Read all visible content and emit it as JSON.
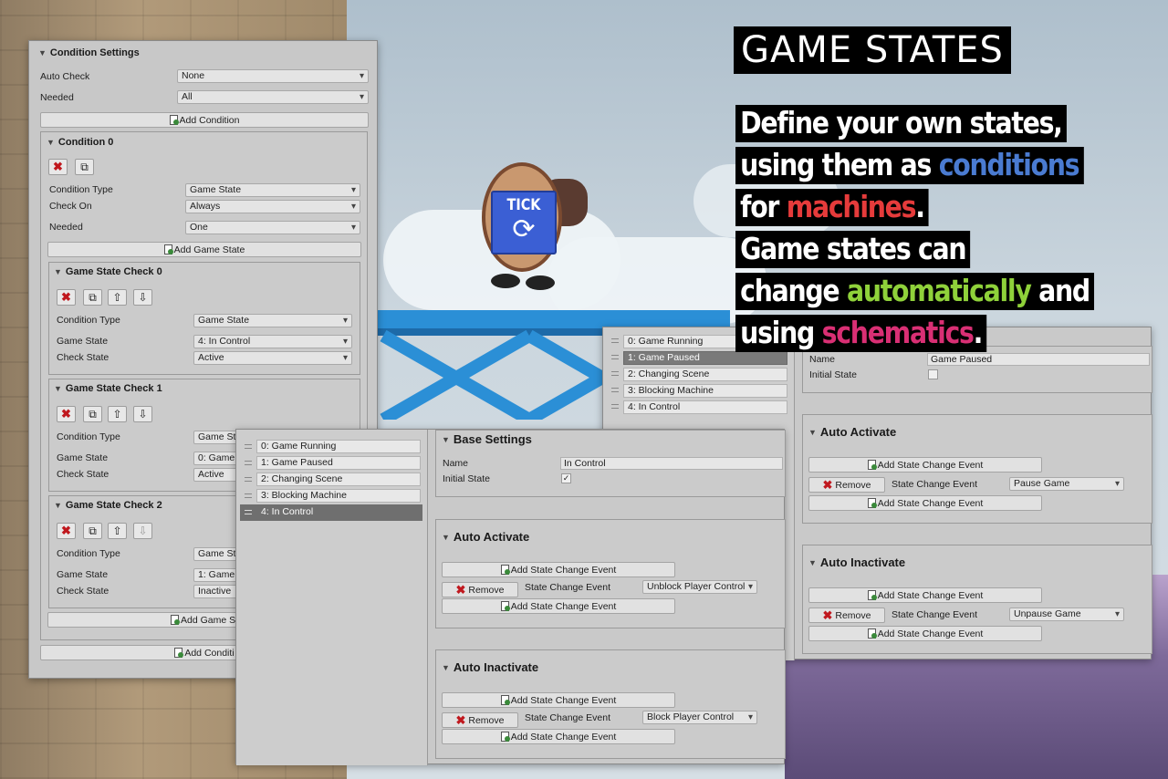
{
  "headline": {
    "title": "GAME STATES",
    "lines": [
      {
        "parts": [
          {
            "t": "Define your own states,",
            "c": "#ffffff"
          }
        ]
      },
      {
        "parts": [
          {
            "t": "using them as ",
            "c": "#ffffff"
          },
          {
            "t": "conditions",
            "c": "#4a7bd1"
          }
        ]
      },
      {
        "parts": [
          {
            "t": "for ",
            "c": "#ffffff"
          },
          {
            "t": "machines",
            "c": "#e63b3b"
          },
          {
            "t": ".",
            "c": "#ffffff"
          }
        ]
      },
      {
        "parts": [
          {
            "t": "Game states can",
            "c": "#ffffff"
          }
        ]
      },
      {
        "parts": [
          {
            "t": "change ",
            "c": "#ffffff"
          },
          {
            "t": "automatically",
            "c": "#8fd13a"
          },
          {
            "t": " and",
            "c": "#ffffff"
          }
        ]
      },
      {
        "parts": [
          {
            "t": "using ",
            "c": "#ffffff"
          },
          {
            "t": "schematics",
            "c": "#d92f74"
          },
          {
            "t": ".",
            "c": "#ffffff"
          }
        ]
      }
    ]
  },
  "tick": {
    "label": "TICK"
  },
  "condition_settings": {
    "title": "Condition Settings",
    "auto_check_label": "Auto Check",
    "auto_check_value": "None",
    "needed_label": "Needed",
    "needed_value": "All",
    "add_condition": "Add Condition",
    "condition0": {
      "title": "Condition 0",
      "type_label": "Condition Type",
      "type_value": "Game State",
      "check_on_label": "Check On",
      "check_on_value": "Always",
      "needed_label": "Needed",
      "needed_value": "One",
      "add_game_state": "Add Game State"
    },
    "checks": [
      {
        "title": "Game State Check 0",
        "type_label": "Condition Type",
        "type_value": "Game State",
        "gs_label": "Game State",
        "gs_value": "4: In Control",
        "cs_label": "Check State",
        "cs_value": "Active"
      },
      {
        "title": "Game State Check 1",
        "type_label": "Condition Type",
        "type_value": "Game St",
        "gs_label": "Game State",
        "gs_value": "0: Game",
        "cs_label": "Check State",
        "cs_value": "Active"
      },
      {
        "title": "Game State Check 2",
        "type_label": "Condition Type",
        "type_value": "Game St",
        "gs_label": "Game State",
        "gs_value": "1: Game",
        "cs_label": "Check State",
        "cs_value": "Inactive"
      }
    ],
    "add_game_state_bottom": "Add Game St",
    "add_condition_bottom": "Add Conditi"
  },
  "states_list": [
    "0: Game Running",
    "1: Game Paused",
    "2: Changing Scene",
    "3: Blocking Machine",
    "4: In Control"
  ],
  "editor_front": {
    "base_title": "Base Settings",
    "name_label": "Name",
    "name_value": "In Control",
    "initial_label": "Initial State",
    "initial_check": "✓",
    "auto_activate": {
      "title": "Auto Activate",
      "add": "Add State Change Event",
      "remove": "Remove",
      "event_label": "State Change Event",
      "event_value": "Unblock Player Control",
      "add2": "Add State Change Event"
    },
    "auto_inactivate": {
      "title": "Auto Inactivate",
      "add": "Add State Change Event",
      "remove": "Remove",
      "event_label": "State Change Event",
      "event_value": "Block Player Control",
      "add2": "Add State Change Event"
    }
  },
  "editor_back": {
    "name_label": "Name",
    "name_value": "Game Paused",
    "initial_label": "Initial State",
    "auto_activate": {
      "title": "Auto Activate",
      "add": "Add State Change Event",
      "remove": "Remove",
      "event_label": "State Change Event",
      "event_value": "Pause Game",
      "add2": "Add State Change Event"
    },
    "auto_inactivate": {
      "title": "Auto Inactivate",
      "add": "Add State Change Event",
      "remove": "Remove",
      "event_label": "State Change Event",
      "event_value": "Unpause Game",
      "add2": "Add State Change Event"
    }
  },
  "icons": [
    "delete-x-icon",
    "copy-icon",
    "move-up-icon",
    "move-down-icon",
    "add-document-icon",
    "refresh-icon",
    "grip-icon"
  ]
}
